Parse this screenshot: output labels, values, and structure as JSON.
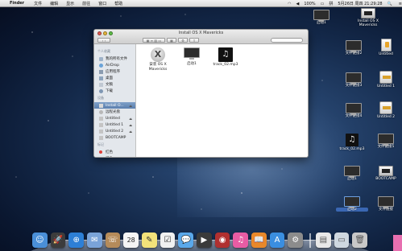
{
  "menubar": {
    "apple_glyph": "",
    "items": [
      "Finder",
      "文件",
      "编辑",
      "显示",
      "前往",
      "窗口",
      "帮助"
    ],
    "status": {
      "battery": "100%",
      "datetime": "5月26日 周四 21:29:28",
      "search_glyph": "🔍"
    }
  },
  "window": {
    "title": "Install OS X Mavericks",
    "search_placeholder": "",
    "sidebar": {
      "favorites_header": "个人收藏",
      "favorites": [
        "我的所有文件",
        "AirDrop",
        "应用程序",
        "桌面",
        "文稿",
        "下载"
      ],
      "devices_header": "设备",
      "devices": [
        {
          "label": "Install O...",
          "eject": "⏏",
          "selected": true
        },
        {
          "label": "远程光盘",
          "eject": "",
          "selected": false
        },
        {
          "label": "Untitled",
          "eject": "⏏",
          "selected": false
        },
        {
          "label": "Untitled 1",
          "eject": "⏏",
          "selected": false
        },
        {
          "label": "Untitled 2",
          "eject": "⏏",
          "selected": false
        },
        {
          "label": "BOOTCAMP",
          "eject": "",
          "selected": false
        }
      ],
      "tags_header": "标记",
      "tags": [
        {
          "label": "红色",
          "color": "#e0413a"
        },
        {
          "label": "橙色",
          "color": "#f0962a"
        }
      ]
    },
    "files": [
      {
        "label": "安装 OS X Mavericks",
        "icon": "os-x-installer-icon"
      },
      {
        "label": "启动1",
        "icon": "laptop-icon"
      },
      {
        "label": "track_02.mp3",
        "icon": "music-file-icon"
      }
    ]
  },
  "desktop_icons": [
    {
      "label": "启动1",
      "icon": "monitor-icon"
    },
    {
      "label": "Install OS X Mavericks",
      "icon": "disk-icon"
    },
    {
      "label": "文件链接2",
      "icon": "monitor-icon"
    },
    {
      "label": "Untitled",
      "icon": "usb-drive-icon"
    },
    {
      "label": "文件链接3",
      "icon": "monitor-icon"
    },
    {
      "label": "Untitled 1",
      "icon": "external-drive-icon"
    },
    {
      "label": "文件链接4",
      "icon": "monitor-icon"
    },
    {
      "label": "track_02.mp3",
      "icon": "music-file-icon"
    },
    {
      "label": "Untitled 2",
      "icon": "external-drive-icon"
    },
    {
      "label": "文件链接5",
      "icon": "monitor-icon"
    },
    {
      "label": "启动1",
      "icon": "monitor-icon"
    },
    {
      "label": "BOOTCAMP",
      "icon": "disk-icon"
    },
    {
      "label": "启动2",
      "icon": "monitor-icon"
    },
    {
      "label": "文件链接",
      "icon": "monitor-icon"
    }
  ],
  "dock": {
    "apps": [
      {
        "name": "finder",
        "glyph": "☺",
        "color": "#4a8fd8"
      },
      {
        "name": "launchpad",
        "glyph": "🚀",
        "color": "#3c3c3c"
      },
      {
        "name": "safari",
        "glyph": "⊕",
        "color": "#2d7fd6"
      },
      {
        "name": "mail",
        "glyph": "✉",
        "color": "#7aa3d8"
      },
      {
        "name": "contacts",
        "glyph": "☏",
        "color": "#b58b5a"
      },
      {
        "name": "calendar",
        "glyph": "28",
        "color": "#f4f4f4"
      },
      {
        "name": "notes",
        "glyph": "✎",
        "color": "#f2e27a"
      },
      {
        "name": "reminders",
        "glyph": "☑",
        "color": "#f0f0f0"
      },
      {
        "name": "messages",
        "glyph": "💬",
        "color": "#5aa8ea"
      },
      {
        "name": "facetime",
        "glyph": "▶",
        "color": "#3a3a3a"
      },
      {
        "name": "photo-booth",
        "glyph": "◉",
        "color": "#b03030"
      },
      {
        "name": "itunes",
        "glyph": "♫",
        "color": "#e85ca4"
      },
      {
        "name": "ibooks",
        "glyph": "📖",
        "color": "#e8882a"
      },
      {
        "name": "app-store",
        "glyph": "A",
        "color": "#3a8ee0"
      },
      {
        "name": "system-preferences",
        "glyph": "⚙",
        "color": "#8c8c8c"
      }
    ],
    "right_items": [
      {
        "name": "document",
        "glyph": "▤",
        "color": "#e8e8e8"
      },
      {
        "name": "downloads",
        "glyph": "▭",
        "color": "#cfd8e0"
      },
      {
        "name": "trash",
        "glyph": "🗑",
        "color": "#c8c8c8"
      }
    ]
  }
}
